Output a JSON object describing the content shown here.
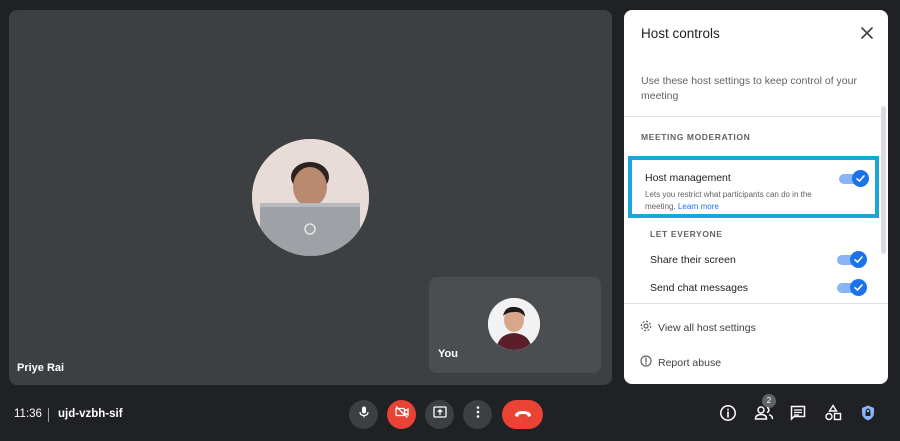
{
  "meeting": {
    "time": "11:36",
    "code": "ujd-vzbh-sif"
  },
  "participants": {
    "main_name": "Priye Rai",
    "self_name": "You",
    "count_badge": "2"
  },
  "panel": {
    "title": "Host controls",
    "description": "Use these host settings to keep control of your meeting",
    "section_moderation": "MEETING MODERATION",
    "host_management": {
      "title": "Host management",
      "description": "Lets you restrict what participants can do in the meeting.",
      "learn_more": "Learn more",
      "enabled": true
    },
    "section_everyone": "LET EVERYONE",
    "share_screen": {
      "label": "Share their screen",
      "enabled": true
    },
    "send_chat": {
      "label": "Send chat messages",
      "enabled": true
    },
    "view_all": "View all host settings",
    "report_abuse": "Report abuse"
  },
  "colors": {
    "accent": "#1a73e8",
    "highlight_border": "#1aa6d8",
    "danger": "#ea4335",
    "background": "#202124",
    "tile": "#3c4043"
  },
  "icons": {
    "mic": "microphone-icon",
    "camera_off": "camera-off-icon",
    "present": "present-screen-icon",
    "more": "more-vert-icon",
    "end": "call-end-icon",
    "info": "info-icon",
    "people": "people-icon",
    "chat": "chat-icon",
    "activities": "activities-icon",
    "host_controls": "shield-lock-icon"
  }
}
